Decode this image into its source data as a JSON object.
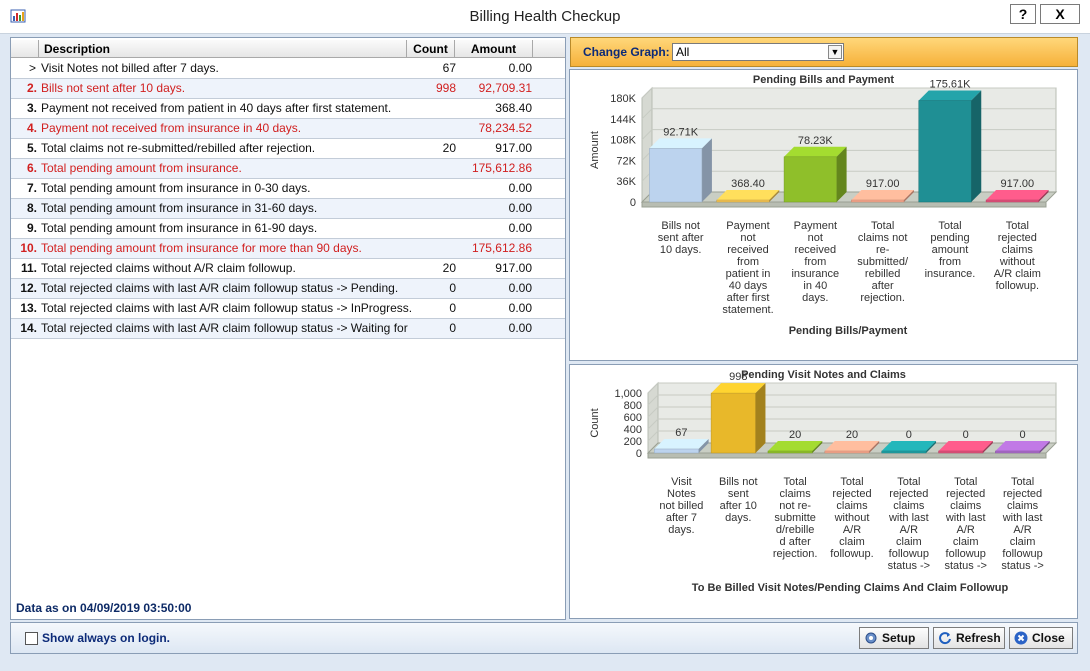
{
  "window": {
    "title": "Billing Health Checkup",
    "help_label": "?",
    "close_label": "X"
  },
  "grid": {
    "headers": {
      "description": "Description",
      "count": "Count",
      "amount": "Amount"
    },
    "rows": [
      {
        "num": "",
        "indicator": ">",
        "desc": "Visit Notes not billed after 7 days.",
        "count": "67",
        "amount": "0.00",
        "red": false
      },
      {
        "num": "2.",
        "indicator": "",
        "desc": "Bills not sent after 10 days.",
        "count": "998",
        "amount": "92,709.31",
        "red": true
      },
      {
        "num": "3.",
        "indicator": "",
        "desc": "Payment not received from patient in 40 days after first statement.",
        "count": "",
        "amount": "368.40",
        "red": false
      },
      {
        "num": "4.",
        "indicator": "",
        "desc": "Payment not received from insurance in 40 days.",
        "count": "",
        "amount": "78,234.52",
        "red": true
      },
      {
        "num": "5.",
        "indicator": "",
        "desc": "Total claims not re-submitted/rebilled after rejection.",
        "count": "20",
        "amount": "917.00",
        "red": false
      },
      {
        "num": "6.",
        "indicator": "",
        "desc": "Total pending amount from insurance.",
        "count": "",
        "amount": "175,612.86",
        "red": true
      },
      {
        "num": "7.",
        "indicator": "",
        "desc": "Total pending amount from insurance in 0-30 days.",
        "count": "",
        "amount": "0.00",
        "red": false
      },
      {
        "num": "8.",
        "indicator": "",
        "desc": "Total pending amount from insurance in 31-60 days.",
        "count": "",
        "amount": "0.00",
        "red": false
      },
      {
        "num": "9.",
        "indicator": "",
        "desc": "Total pending amount from insurance in 61-90 days.",
        "count": "",
        "amount": "0.00",
        "red": false
      },
      {
        "num": "10.",
        "indicator": "",
        "desc": "Total pending amount from insurance for more than 90 days.",
        "count": "",
        "amount": "175,612.86",
        "red": true
      },
      {
        "num": "11.",
        "indicator": "",
        "desc": "Total rejected claims without A/R claim followup.",
        "count": "20",
        "amount": "917.00",
        "red": false
      },
      {
        "num": "12.",
        "indicator": "",
        "desc": "Total rejected claims with last A/R claim followup status -> Pending.",
        "count": "0",
        "amount": "0.00",
        "red": false
      },
      {
        "num": "13.",
        "indicator": "",
        "desc": "Total rejected claims with last A/R claim followup status -> InProgress.",
        "count": "0",
        "amount": "0.00",
        "red": false
      },
      {
        "num": "14.",
        "indicator": "",
        "desc": "Total rejected claims with last A/R claim followup status -> Waiting for reply.",
        "count": "0",
        "amount": "0.00",
        "red": false
      }
    ],
    "data_as_on": "Data as on 04/09/2019 03:50:00"
  },
  "change_graph": {
    "label": "Change Graph:",
    "selected": "All"
  },
  "chart_data": [
    {
      "type": "bar",
      "title": "Pending Bills and Payment",
      "xlabel": "Pending Bills/Payment",
      "ylabel": "Amount",
      "ylim": [
        0,
        180000
      ],
      "yticks": [
        "0",
        "36K",
        "72K",
        "108K",
        "144K",
        "180K"
      ],
      "categories": [
        [
          "Bills not",
          "sent after",
          "10 days."
        ],
        [
          "Payment",
          "not",
          "received",
          "from",
          "patient in",
          "40 days",
          "after first",
          "statement."
        ],
        [
          "Payment",
          "not",
          "received",
          "from",
          "insurance",
          "in 40",
          "days."
        ],
        [
          "Total",
          "claims not",
          "re-",
          "submitted/",
          "rebilled",
          "after",
          "rejection."
        ],
        [
          "Total",
          "pending",
          "amount",
          "from",
          "insurance."
        ],
        [
          "Total",
          "rejected",
          "claims",
          "without",
          "A/R claim",
          "followup."
        ]
      ],
      "values": [
        92709.31,
        368.4,
        78234.52,
        917.0,
        175612.86,
        917.0
      ],
      "labels": [
        "92.71K",
        "368.40",
        "78.23K",
        "917.00",
        "175.61K",
        "917.00"
      ],
      "colors": [
        "#bcd3ee",
        "#f2c250",
        "#8fbf2a",
        "#f4a58a",
        "#1f8f94",
        "#e0507a"
      ]
    },
    {
      "type": "bar",
      "title": "Pending Visit Notes and Claims",
      "xlabel": "To Be Billed Visit Notes/Pending Claims And Claim Followup",
      "ylabel": "Count",
      "ylim": [
        0,
        1000
      ],
      "yticks": [
        "0",
        "200",
        "400",
        "600",
        "800",
        "1,000"
      ],
      "categories": [
        [
          "Visit",
          "Notes",
          "not billed",
          "after 7",
          "days."
        ],
        [
          "Bills not",
          "sent",
          "after 10",
          "days."
        ],
        [
          "Total",
          "claims",
          "not re-",
          "submitte",
          "d/rebille",
          "d after",
          "rejection."
        ],
        [
          "Total",
          "rejected",
          "claims",
          "without",
          "A/R",
          "claim",
          "followup."
        ],
        [
          "Total",
          "rejected",
          "claims",
          "with last",
          "A/R",
          "claim",
          "followup",
          "status ->"
        ],
        [
          "Total",
          "rejected",
          "claims",
          "with last",
          "A/R",
          "claim",
          "followup",
          "status ->"
        ],
        [
          "Total",
          "rejected",
          "claims",
          "with last",
          "A/R",
          "claim",
          "followup",
          "status ->"
        ]
      ],
      "values": [
        67,
        998,
        20,
        20,
        0,
        0,
        0
      ],
      "labels": [
        "67",
        "998",
        "20",
        "20",
        "0",
        "0",
        "0"
      ],
      "colors": [
        "#bcd3ee",
        "#e8b82a",
        "#8fbf2a",
        "#f4a58a",
        "#1f9fa3",
        "#e0507a",
        "#a869c8"
      ]
    }
  ],
  "footer": {
    "show_always_label": "Show always on login.",
    "setup_label": "Setup",
    "refresh_label": "Refresh",
    "close_label": "Close"
  }
}
